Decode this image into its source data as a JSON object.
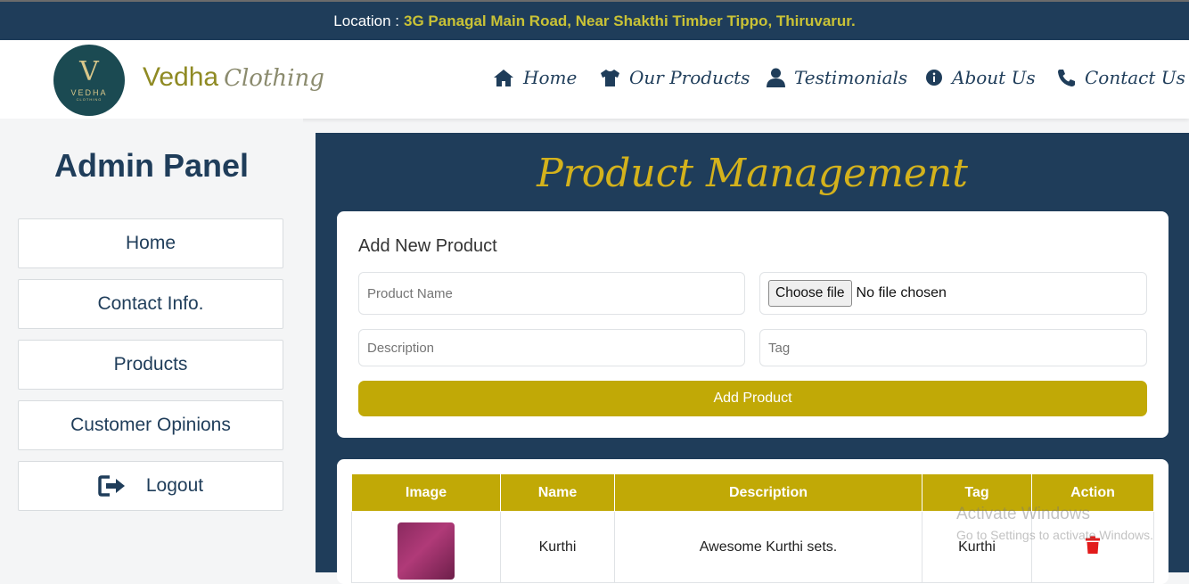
{
  "topbar": {
    "label": "Location :",
    "address": "3G Panagal Main Road, Near Shakthi Timber Tippo, Thiruvarur."
  },
  "logo": {
    "mono": "V",
    "word": "VEDHA",
    "sub": "CLOTHING"
  },
  "brand": {
    "name": "Vedha",
    "suffix": "Clothing"
  },
  "nav": {
    "home": "Home",
    "products": "Our Products",
    "testimonials": "Testimonials",
    "about": "About Us",
    "contact": "Contact Us"
  },
  "sidebar": {
    "title": "Admin Panel",
    "items": [
      "Home",
      "Contact Info.",
      "Products",
      "Customer Opinions"
    ],
    "logout": "Logout"
  },
  "main": {
    "title": "Product Management",
    "form": {
      "heading": "Add New Product",
      "name_placeholder": "Product Name",
      "file_button": "Choose file",
      "file_status": "No file chosen",
      "description_placeholder": "Description",
      "tag_placeholder": "Tag",
      "submit": "Add Product"
    },
    "table": {
      "headers": [
        "Image",
        "Name",
        "Description",
        "Tag",
        "Action"
      ],
      "rows": [
        {
          "name": "Kurthi",
          "description": "Awesome Kurthi sets.",
          "tag": "Kurthi"
        }
      ]
    }
  },
  "watermark": {
    "line1": "Activate Windows",
    "line2": "Go to Settings to activate Windows."
  },
  "colors": {
    "navy": "#1f3d5a",
    "gold": "#c1a906",
    "delete": "#e21b1b"
  }
}
